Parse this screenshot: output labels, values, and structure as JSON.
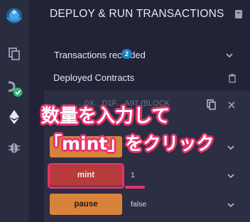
{
  "header": {
    "title": "DEPLOY & RUN TRANSACTIONS"
  },
  "transactions": {
    "label": "Transactions recorded",
    "count": "2"
  },
  "deployed": {
    "label": "Deployed Contracts"
  },
  "contract": {
    "address_label": "...0X…D1F…A97 (BLOCK"
  },
  "functions": [
    {
      "label": "",
      "value": "",
      "color": "#d9833a"
    },
    {
      "label": "mint",
      "value": "1",
      "color": "#b83b3b"
    },
    {
      "label": "pause",
      "value": "false",
      "color": "#d9833a"
    }
  ],
  "annotations": {
    "line1": "数量を入力して",
    "line2": "「mint」をクリック"
  },
  "colors": {
    "highlight": "#e8336d",
    "accent": "#d9833a",
    "mint_button": "#b83b3b",
    "badge": "#1b7fc0"
  }
}
